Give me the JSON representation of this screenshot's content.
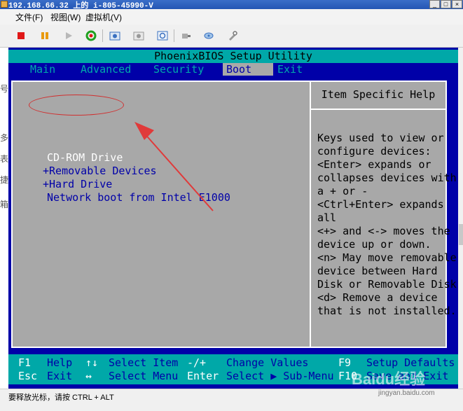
{
  "window": {
    "title": "192.168.66.32 上的 i-805-45990-V",
    "buttons": [
      "_",
      "□",
      "×"
    ]
  },
  "menubar": {
    "items": [
      "文件(F)",
      "视图(W)",
      "虚拟机(V)"
    ]
  },
  "toolbar": {
    "icons": [
      "stop-icon",
      "pause-icon",
      "play-icon",
      "reset-icon",
      "snapshot-icon",
      "revert-icon",
      "snapshot-manager-icon",
      "usb-icon",
      "network-icon",
      "settings-icon"
    ]
  },
  "bios": {
    "title": "PhoenixBIOS Setup Utility",
    "tabs": [
      "Main",
      "Advanced",
      "Security",
      "Boot",
      "Exit"
    ],
    "active_tab": "Boot",
    "boot_items": [
      "CD-ROM Drive",
      "+Removable Devices",
      "+Hard Drive",
      "Network boot from Intel E1000"
    ],
    "selected_item": "CD-ROM Drive",
    "help_title": "Item Specific Help",
    "help_lines": [
      "Keys used to view or",
      "configure devices:",
      "<Enter> expands or",
      "collapses devices with",
      "a + or -",
      "<Ctrl+Enter> expands",
      "all",
      "<+> and <-> moves the",
      "device up or down.",
      "<n> May move removable",
      "device between Hard",
      "Disk or Removable Disk",
      "<d> Remove a device",
      "that is not installed."
    ],
    "footer": {
      "row1": [
        {
          "key": "F1",
          "desc": "Help"
        },
        {
          "key": "↑↓",
          "desc": "Select Item"
        },
        {
          "key": "-/+",
          "desc": "Change Values"
        },
        {
          "key": "F9",
          "desc": "Setup Defaults"
        }
      ],
      "row2": [
        {
          "key": "Esc",
          "desc": "Exit"
        },
        {
          "key": "↔",
          "desc": "Select Menu"
        },
        {
          "key": "Enter",
          "desc": "Select ▶ Sub-Menu"
        },
        {
          "key": "F10",
          "desc": "Save and Exit"
        }
      ]
    }
  },
  "statusbar": {
    "text": "要释放光标，请按 CTRL + ALT"
  },
  "watermark": {
    "brand": "Baidu经验",
    "url": "jingyan.baidu.com"
  },
  "colors": {
    "bios_blue": "#0000a8",
    "bios_cyan": "#00a8a8",
    "bios_gray": "#a8a8a8",
    "annotation_red": "#d03030"
  }
}
